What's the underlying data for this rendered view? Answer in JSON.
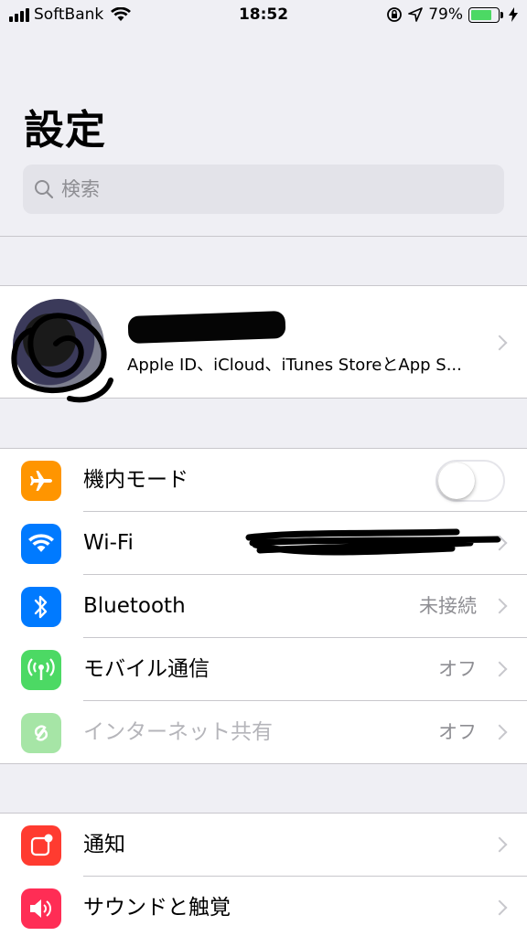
{
  "status_bar": {
    "carrier": "SoftBank",
    "time": "18:52",
    "battery_percent": "79%",
    "battery_level": 0.79,
    "icons": [
      "signal-icon",
      "wifi-icon",
      "rotation-lock-icon",
      "location-icon",
      "battery-icon",
      "charging-icon"
    ]
  },
  "title": "設定",
  "search": {
    "placeholder": "検索"
  },
  "apple_id": {
    "subtitle": "Apple ID、iCloud、iTunes StoreとApp S..."
  },
  "network_section": [
    {
      "label": "機内モード",
      "icon": "airplane-icon",
      "color": "#ff9500",
      "control": "toggle",
      "on": false
    },
    {
      "label": "Wi-Fi",
      "icon": "wifi-icon",
      "color": "#007aff",
      "value": ""
    },
    {
      "label": "Bluetooth",
      "icon": "bluetooth-icon",
      "color": "#007aff",
      "value": "未接続"
    },
    {
      "label": "モバイル通信",
      "icon": "cellular-icon",
      "color": "#4cd964",
      "value": "オフ"
    },
    {
      "label": "インターネット共有",
      "icon": "hotspot-icon",
      "color": "#a6e5a6",
      "value": "オフ",
      "disabled": true
    }
  ],
  "notify_section": [
    {
      "label": "通知",
      "icon": "notifications-icon",
      "color": "#ff3b30"
    },
    {
      "label": "サウンドと触覚",
      "icon": "sounds-icon",
      "color": "#ff2d55"
    }
  ]
}
